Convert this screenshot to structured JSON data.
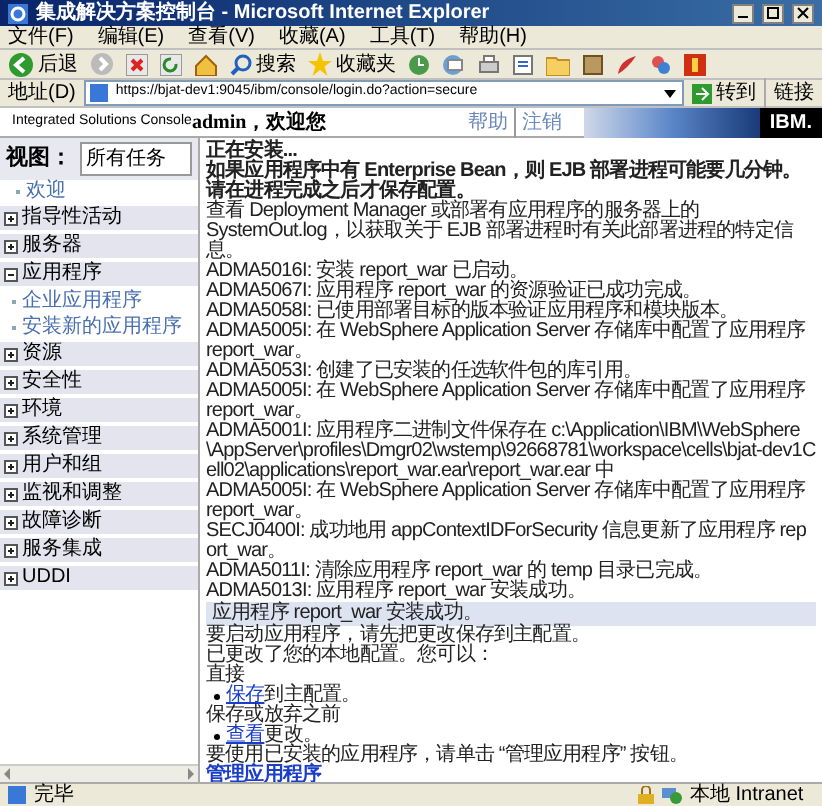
{
  "window": {
    "title": "集成解决方案控制台 - Microsoft Internet Explorer"
  },
  "menu": [
    "文件(F)",
    "编辑(E)",
    "查看(V)",
    "收藏(A)",
    "工具(T)",
    "帮助(H)"
  ],
  "toolbar": {
    "back": "后退",
    "search": "搜索",
    "favorites": "收藏夹"
  },
  "address_bar": {
    "label": "地址(D)",
    "url": "https://bjat-dev1:9045/ibm/console/login.do?action=secure",
    "go": "转到",
    "links": "链接"
  },
  "header": {
    "product": "Integrated Solutions Console",
    "welcome": "admin，欢迎您",
    "links": [
      "帮助",
      "注销"
    ],
    "logo": "IBM."
  },
  "nav": {
    "view_label": "视图：",
    "view_value": "所有任务",
    "items": [
      {
        "label": "欢迎",
        "kind": "link"
      },
      {
        "label": "指导性活动",
        "kind": "group",
        "expanded": false
      },
      {
        "label": "服务器",
        "kind": "group",
        "expanded": false
      },
      {
        "label": "应用程序",
        "kind": "group",
        "expanded": true,
        "children": [
          {
            "label": "企业应用程序"
          },
          {
            "label": "安装新的应用程序"
          }
        ]
      },
      {
        "label": "资源",
        "kind": "group",
        "expanded": false
      },
      {
        "label": "安全性",
        "kind": "group",
        "expanded": false
      },
      {
        "label": "环境",
        "kind": "group",
        "expanded": false
      },
      {
        "label": "系统管理",
        "kind": "group",
        "expanded": false
      },
      {
        "label": "用户和组",
        "kind": "group",
        "expanded": false
      },
      {
        "label": "监视和调整",
        "kind": "group",
        "expanded": false
      },
      {
        "label": "故障诊断",
        "kind": "group",
        "expanded": false
      },
      {
        "label": "服务集成",
        "kind": "group",
        "expanded": false
      },
      {
        "label": "UDDI",
        "kind": "group",
        "expanded": false
      }
    ]
  },
  "content": {
    "heading": "正在安装...",
    "warning": "如果应用程序中有 Enterprise Bean，则 EJB 部署进程可能要几分钟。请在进程完成之后才保存配置。",
    "note": "查看 Deployment Manager 或部署有应用程序的服务器上的 SystemOut.log，以获取关于 EJB 部署进程时有关此部署进程的特定信息。",
    "messages": [
      "ADMA5016I: 安装 report_war 已启动。",
      "ADMA5067I: 应用程序 report_war 的资源验证已成功完成。",
      "ADMA5058I: 已使用部署目标的版本验证应用程序和模块版本。",
      "ADMA5005I: 在 WebSphere Application Server 存储库中配置了应用程序 report_war。",
      "ADMA5053I: 创建了已安装的任选软件包的库引用。",
      "ADMA5005I: 在 WebSphere Application Server 存储库中配置了应用程序 report_war。",
      "ADMA5001I: 应用程序二进制文件保存在 c:\\Application\\IBM\\WebSphere\\AppServer\\profiles\\Dmgr02\\wstemp\\92668781\\workspace\\cells\\bjat-dev1Cell02\\applications\\report_war.ear\\report_war.ear 中",
      "ADMA5005I: 在 WebSphere Application Server 存储库中配置了应用程序 report_war。",
      "SECJ0400I: 成功地用 appContextIDForSecurity 信息更新了应用程序 report_war。",
      "ADMA5011I: 清除应用程序 report_war 的 temp 目录已完成。",
      "ADMA5013I: 应用程序 report_war 安装成功。"
    ],
    "result": "应用程序 report_war 安装成功。",
    "save_hint": "要启动应用程序，请先把更改保存到主配置。",
    "changed": "已更改了您的本地配置。您可以：",
    "direct": "直接",
    "options": [
      {
        "kind": "bullet",
        "link": "保存",
        "text": "到主配置。"
      },
      {
        "kind": "line",
        "text": "保存或放弃之前"
      },
      {
        "kind": "bullet",
        "link": "查看",
        "text": "更改。"
      }
    ],
    "manage_hint": "要使用已安装的应用程序，请单击 “管理应用程序” 按钮。",
    "manage_link": "管理应用程序"
  },
  "status_bar": {
    "text": "完毕",
    "zone": "本地 Intranet"
  }
}
